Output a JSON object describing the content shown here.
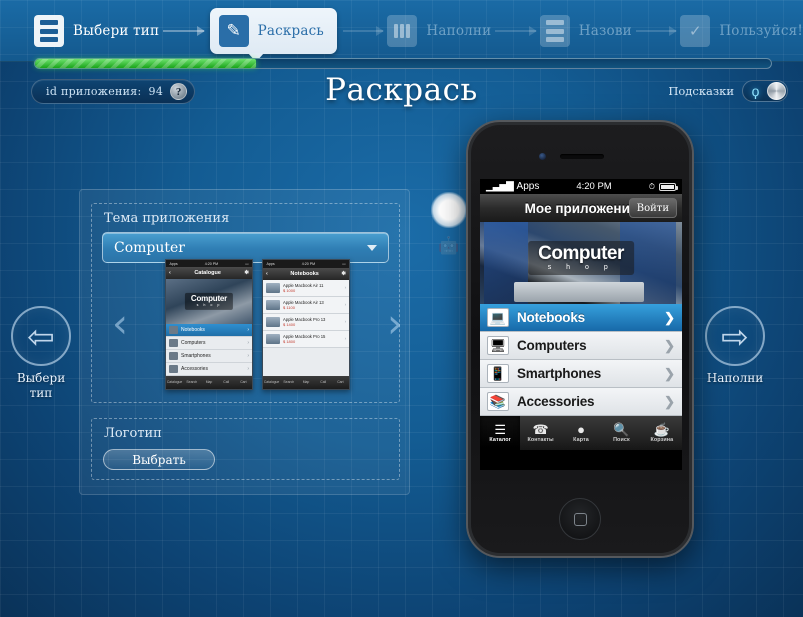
{
  "stepbar": {
    "steps": [
      {
        "label": "Выбери тип",
        "icon": "list-icon",
        "state": "done"
      },
      {
        "label": "Раскрась",
        "icon": "paint-brush-icon",
        "state": "active"
      },
      {
        "label": "Наполни",
        "icon": "sliders-icon",
        "state": "todo"
      },
      {
        "label": "Назови",
        "icon": "id-card-icon",
        "state": "todo"
      },
      {
        "label": "Пользуйся!",
        "icon": "phone-check-icon",
        "state": "todo"
      }
    ]
  },
  "progress": {
    "percent": 30
  },
  "app_id": {
    "label": "id приложения:",
    "value": "94",
    "help": "?"
  },
  "page": {
    "title": "Раскрась"
  },
  "hints": {
    "label": "Подсказки",
    "bulb_icon": "lightbulb-icon",
    "state": "on"
  },
  "editor": {
    "theme": {
      "legend": "Тема приложения",
      "selected": "Computer",
      "caret_icon": "chevron-down-icon",
      "prev_icon": "chevron-left-icon",
      "next_icon": "chevron-right-icon"
    },
    "logo": {
      "legend": "Логотип",
      "button": "Выбрать"
    }
  },
  "thumbnails": [
    {
      "status": {
        "carrier": "Apps",
        "time": "4:20 PM"
      },
      "title": "Catalogue",
      "hero": {
        "title": "Computer",
        "sub": "s h o p"
      },
      "rows": [
        {
          "label": "Notebooks",
          "selected": true
        },
        {
          "label": "Computers",
          "selected": false
        },
        {
          "label": "Smartphones",
          "selected": false
        },
        {
          "label": "Accessories",
          "selected": false
        }
      ],
      "tabs": [
        "Catalogue",
        "Search",
        "Map",
        "Call",
        "Cart"
      ]
    },
    {
      "status": {
        "carrier": "Apps",
        "time": "4:20 PM"
      },
      "title": "Notebooks",
      "products": [
        {
          "name": "Apple Macbook Air 11",
          "price": "$ 1000"
        },
        {
          "name": "Apple Macbook Air 13",
          "price": "$ 1100"
        },
        {
          "name": "Apple Macbook Pro 13",
          "price": "$ 1400"
        },
        {
          "name": "Apple Macbook Pro 15",
          "price": "$ 1800"
        }
      ],
      "tabs": [
        "Catalogue",
        "Search",
        "Map",
        "Call",
        "Cart"
      ]
    }
  ],
  "platforms": [
    {
      "name": "apple-icon",
      "glyph": "",
      "active": true
    },
    {
      "name": "android-icon",
      "glyph": "🤖",
      "active": false
    }
  ],
  "nav": {
    "prev": {
      "caption_line1": "Выбери",
      "caption_line2": "тип",
      "icon": "arrow-left-icon",
      "glyph": "⇦"
    },
    "next": {
      "caption_line1": "Наполни",
      "caption_line2": "",
      "icon": "arrow-right-icon",
      "glyph": "⇨"
    }
  },
  "preview": {
    "status": {
      "carrier": "Apps",
      "signal": "▁▃▅▇",
      "time": "4:20 PM",
      "alarm": "⏱"
    },
    "navbar": {
      "title": "Мое приложение",
      "login": "Войти"
    },
    "hero": {
      "title": "Computer",
      "sub": "s h o p"
    },
    "list": [
      {
        "label": "Notebooks",
        "icon": "laptop-icon",
        "glyph": "💻",
        "selected": true
      },
      {
        "label": "Computers",
        "icon": "desktop-icon",
        "glyph": "🖥",
        "selected": false
      },
      {
        "label": "Smartphones",
        "icon": "smartphone-icon",
        "glyph": "📱",
        "selected": false
      },
      {
        "label": "Accessories",
        "icon": "books-icon",
        "glyph": "📚",
        "selected": false
      }
    ],
    "tabs": [
      {
        "label": "Каталог",
        "icon": "list-icon",
        "glyph": "☰",
        "active": true
      },
      {
        "label": "Контакты",
        "icon": "phone-icon",
        "glyph": "✆",
        "active": false
      },
      {
        "label": "Карта",
        "icon": "pin-icon",
        "glyph": "📍",
        "active": false
      },
      {
        "label": "Поиск",
        "icon": "search-icon",
        "glyph": "🔍",
        "active": false
      },
      {
        "label": "Корзина",
        "icon": "basket-icon",
        "glyph": "🛒",
        "active": false
      }
    ]
  },
  "colors": {
    "accent": "#1769a8",
    "progress": "#19a319",
    "panel_bg": "#0d4a7d"
  }
}
